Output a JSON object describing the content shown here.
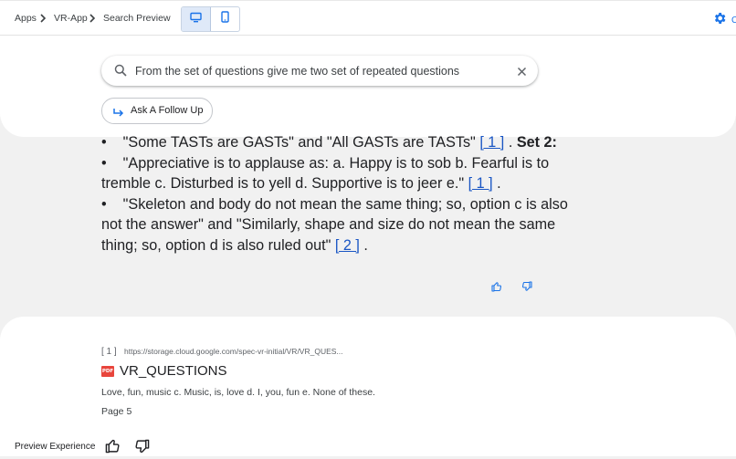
{
  "breadcrumb": {
    "items": [
      "Apps",
      "VR-App",
      "Search Preview"
    ]
  },
  "device_toggle": {
    "options": [
      "desktop-icon",
      "mobile-icon"
    ],
    "active": "desktop-icon"
  },
  "settings": {
    "icon": "gear-icon",
    "label": "C"
  },
  "search": {
    "query": "From the set of questions give me two set of repeated questions",
    "icon": "search-icon",
    "clear_icon": "close-icon"
  },
  "followup": {
    "label": "Ask A Follow Up",
    "icon": "reply-arrow-icon"
  },
  "answer": {
    "line1_quote": "\"Some TASTs are GASTs\" and \"All GASTs are TASTs\"",
    "line1_cite": "[ 1 ]",
    "line1_tail": ".",
    "line1_bold": "Set 2:",
    "line2a": "\"Appreciative is to applause as: a. Happy is to sob b. Fearful is to",
    "line2b": "tremble c. Disturbed is to yell d. Supportive is to jeer e.\"",
    "line2_cite": "[ 1 ]",
    "line2_tail": ".",
    "line3a": "\"Skeleton and body do not mean the same thing; so, option c is also",
    "line3b": "not the answer\" and \"Similarly, shape and size do not mean the same",
    "line3c": "thing; so, option d is also ruled out\"",
    "line3_cite": "[ 2 ]",
    "line3_tail": ".",
    "bullet": "•"
  },
  "feedback": {
    "up_icon": "thumbs-up-icon",
    "down_icon": "thumbs-down-icon"
  },
  "source": {
    "index": "[ 1 ]",
    "url": "https://storage.cloud.google.com/spec-vr-initial/VR/VR_QUES...",
    "file_badge": "PDF",
    "title": "VR_QUESTIONS",
    "snippet": "Love, fun, music c. Music, is, love d. I, you, fun e. None of these.",
    "page": "Page 5"
  },
  "preview": {
    "label": "Preview Experience"
  }
}
